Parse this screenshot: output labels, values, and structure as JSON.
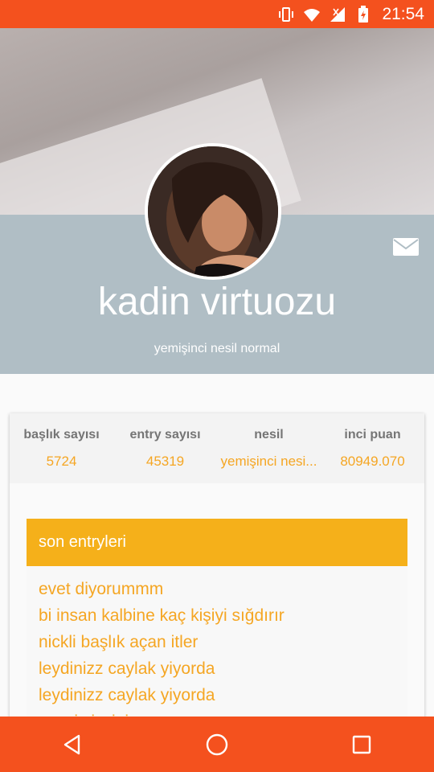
{
  "status_bar": {
    "time": "21:54",
    "icons": [
      "vibrate-icon",
      "wifi-icon",
      "signal-icon",
      "battery-charging-icon"
    ]
  },
  "profile": {
    "name": "kadin virtuozu",
    "subtitle": "yemişinci nesil normal",
    "icons": {
      "message": "mail-icon"
    }
  },
  "stats": [
    {
      "label": "başlık sayısı",
      "value": "5724"
    },
    {
      "label": "entry sayısı",
      "value": "45319"
    },
    {
      "label": "nesil",
      "value": "yemişinci nesi..."
    },
    {
      "label": "inci puan",
      "value": "80949.070"
    }
  ],
  "entries": {
    "title": "son entryleri",
    "items": [
      "evet diyorummm",
      "bi insan kalbine kaç kişiyi sığdırır",
      "nickli başlık açan itler",
      "leydinizz caylak yiyorda",
      "leydinizz caylak yiyorda",
      "sevgi sizsiniz"
    ]
  },
  "nav_bar": {
    "icons": [
      "back-icon",
      "home-icon",
      "recents-icon"
    ]
  },
  "colors": {
    "status_bar": "#f4511e",
    "header_band": "#b0bec5",
    "accent": "#f5a623",
    "entries_header": "#f5b01a"
  }
}
